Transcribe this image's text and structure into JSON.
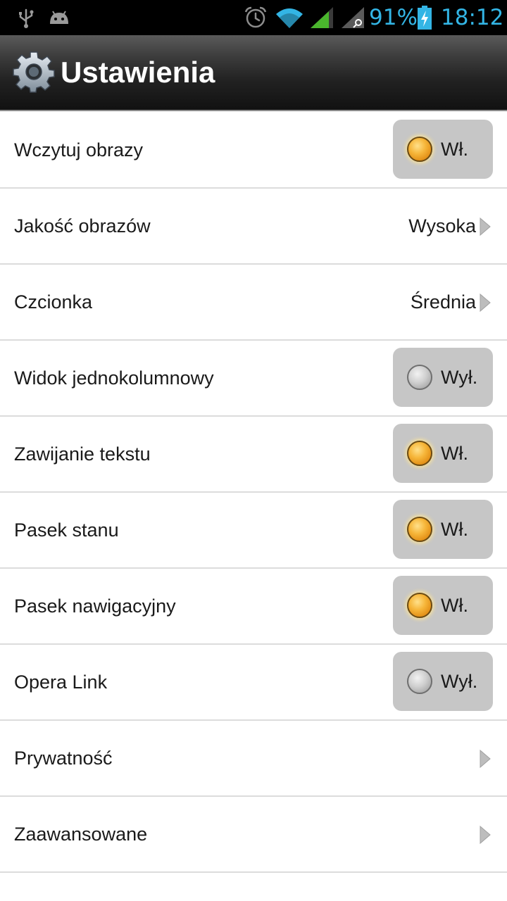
{
  "status_bar": {
    "battery": "91%",
    "time": "18:12",
    "icons": [
      "usb-icon",
      "android-icon",
      "alarm-icon",
      "wifi-icon",
      "signal-icon",
      "signal-roaming-icon",
      "battery-charging-icon"
    ],
    "accent_color": "#33b5e5"
  },
  "action_bar": {
    "icon": "gear-icon",
    "title": "Ustawienia"
  },
  "settings": {
    "load_images": {
      "label": "Wczytuj obrazy",
      "state": "Wł.",
      "on": true
    },
    "image_quality": {
      "label": "Jakość obrazów",
      "value": "Wysoka"
    },
    "font": {
      "label": "Czcionka",
      "value": "Średnia"
    },
    "single_column": {
      "label": "Widok jednokolumnowy",
      "state": "Wył.",
      "on": false
    },
    "text_wrap": {
      "label": "Zawijanie tekstu",
      "state": "Wł.",
      "on": true
    },
    "status_bar": {
      "label": "Pasek stanu",
      "state": "Wł.",
      "on": true
    },
    "nav_bar": {
      "label": "Pasek nawigacyjny",
      "state": "Wł.",
      "on": true
    },
    "opera_link": {
      "label": "Opera Link",
      "state": "Wył.",
      "on": false
    },
    "privacy": {
      "label": "Prywatność"
    },
    "advanced": {
      "label": "Zaawansowane"
    }
  },
  "colors": {
    "led_on": "#f6b63a",
    "led_off": "#bdbdbd",
    "toggle_bg": "#c6c6c6",
    "divider": "#dcdcdc"
  }
}
